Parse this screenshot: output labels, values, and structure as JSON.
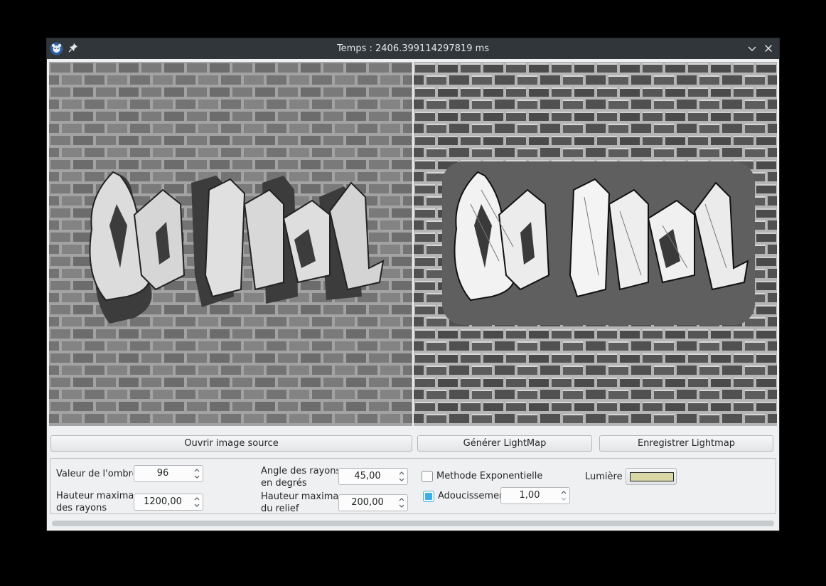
{
  "window": {
    "title": "Temps : 2406.399114297819 ms"
  },
  "icons": {
    "app": "gimp-icon",
    "pin": "pin-icon",
    "minimize": "chevron-down-icon",
    "close": "close-icon"
  },
  "images": {
    "source_text": "OLD School",
    "result_text": "OLD School"
  },
  "buttons": {
    "open_source": "Ouvrir image source",
    "generate": "Générer LightMap",
    "save": "Enregistrer Lightmap"
  },
  "controls": {
    "shadow_value": {
      "label": "Valeur de l'ombre",
      "value": "96"
    },
    "max_ray_height": {
      "label_line1": "Hauteur maximale",
      "label_line2": "des rayons",
      "value": "1200,00"
    },
    "ray_angle": {
      "label_line1": "Angle des rayons",
      "label_line2": "en degrés",
      "value": "45,00"
    },
    "max_relief_height": {
      "label_line1": "Hauteur maximale",
      "label_line2": "du relief",
      "value": "200,00"
    },
    "exponential": {
      "label": "Methode Exponentielle",
      "checked": false
    },
    "smoothing": {
      "label": "Adoucissement",
      "checked": true,
      "value": "1,00"
    },
    "light": {
      "label": "Lumière :",
      "color": "#d9d7a6"
    }
  },
  "colors": {
    "titlebar": "#31363b",
    "accent": "#3daee9",
    "window_bg": "#eff0f1"
  }
}
